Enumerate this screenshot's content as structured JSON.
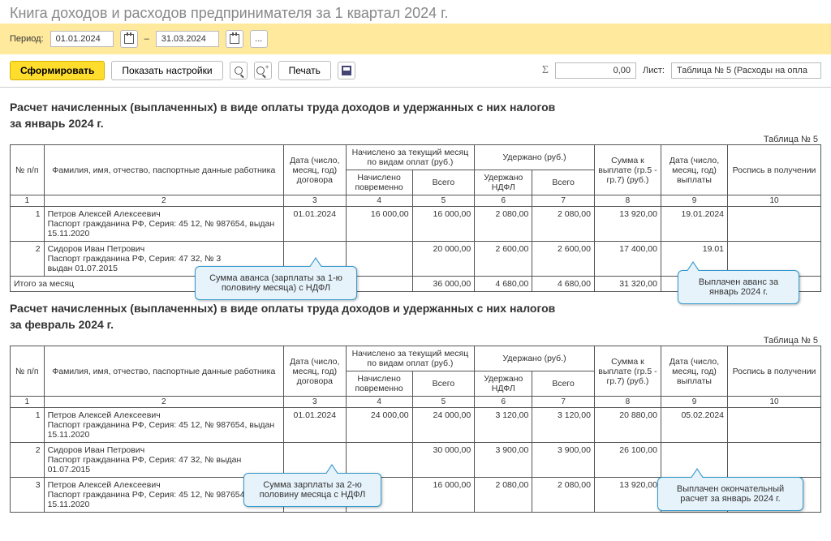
{
  "header": {
    "title": "Книга доходов и расходов предпринимателя за 1 квартал 2024 г."
  },
  "period": {
    "label": "Период:",
    "from": "01.01.2024",
    "dash": "–",
    "to": "31.03.2024",
    "dots": "..."
  },
  "toolbar": {
    "generate": "Сформировать",
    "settings": "Показать настройки",
    "print": "Печать",
    "sum_value": "0,00",
    "sheet_label": "Лист:",
    "sheet_value": "Таблица № 5 (Расходы на опла"
  },
  "section1": {
    "title_l1": "Расчет начисленных (выплаченных) в виде оплаты труда доходов и удержанных с них налогов",
    "title_l2": "за январь 2024 г.",
    "table_num": "Таблица № 5"
  },
  "section2": {
    "title_l1": "Расчет начисленных (выплаченных) в виде оплаты труда доходов и удержанных с них налогов",
    "title_l2": "за февраль 2024 г.",
    "table_num": "Таблица № 5"
  },
  "cols": {
    "c1": "№ п/п",
    "c2": "Фамилия, имя, отчество, паспортные данные работника",
    "c3": "Дата (число, месяц, год) договора",
    "c4g": "Начислено за текущий месяц по видам оплат (руб.)",
    "c4": "Начислено повременно",
    "c5": "Всего",
    "c6g": "Удержано (руб.)",
    "c6": "Удержано НДФЛ",
    "c7": "Всего",
    "c8": "Сумма к выплате (гр.5 - гр.7) (руб.)",
    "c9": "Дата (число, месяц, год) выплаты",
    "c10": "Роспись в получении",
    "n1": "1",
    "n2": "2",
    "n3": "3",
    "n4": "4",
    "n5": "5",
    "n6": "6",
    "n7": "7",
    "n8": "8",
    "n9": "9",
    "n10": "10"
  },
  "emp1": {
    "name": "Петров Алексей Алексеевич",
    "pass": "Паспорт гражданина РФ, Серия: 45 12, № 987654, выдан 15.11.2020"
  },
  "emp2": {
    "name": "Сидоров Иван Петрович",
    "pass": "Паспорт гражданина РФ, Серия: 47 32, № 3",
    "pass_full": "Паспорт гражданина РФ, Серия: 47 32, № выдан 01.07.2015"
  },
  "t1": {
    "r1": {
      "no": "1",
      "date": "01.01.2024",
      "accr": "16 000,00",
      "total": "16 000,00",
      "ndfl": "2 080,00",
      "wtot": "2 080,00",
      "pay": "13 920,00",
      "pdate": "19.01.2024"
    },
    "r2": {
      "no": "2",
      "date": "",
      "accr": "",
      "total": "20 000,00",
      "ndfl": "2 600,00",
      "wtot": "2 600,00",
      "pay": "17 400,00",
      "pdate": "19.01"
    },
    "total_label": "Итого за месяц",
    "total": {
      "accr": "",
      "total": "36 000,00",
      "ndfl": "4 680,00",
      "wtot": "4 680,00",
      "pay": "31 320,00"
    }
  },
  "t2": {
    "r1": {
      "no": "1",
      "date": "01.01.2024",
      "accr": "24 000,00",
      "total": "24 000,00",
      "ndfl": "3 120,00",
      "wtot": "3 120,00",
      "pay": "20 880,00",
      "pdate": "05.02.2024"
    },
    "r2": {
      "no": "2",
      "date": "",
      "accr": "",
      "total": "30 000,00",
      "ndfl": "3 900,00",
      "wtot": "3 900,00",
      "pay": "26 100,00",
      "pdate": ""
    },
    "r3": {
      "no": "3",
      "date": "",
      "accr": "",
      "total": "16 000,00",
      "ndfl": "2 080,00",
      "wtot": "2 080,00",
      "pay": "13 920,00",
      "pdate": ""
    }
  },
  "callouts": {
    "c1": "Сумма аванса (зарплаты за 1-ю половину месяца) с НДФЛ",
    "c2": "Выплачен аванс за январь 2024 г.",
    "c3": "Сумма зарплаты за 2-ю половину месяца с НДФЛ",
    "c4": "Выплачен окончательный расчет за январь 2024 г."
  }
}
